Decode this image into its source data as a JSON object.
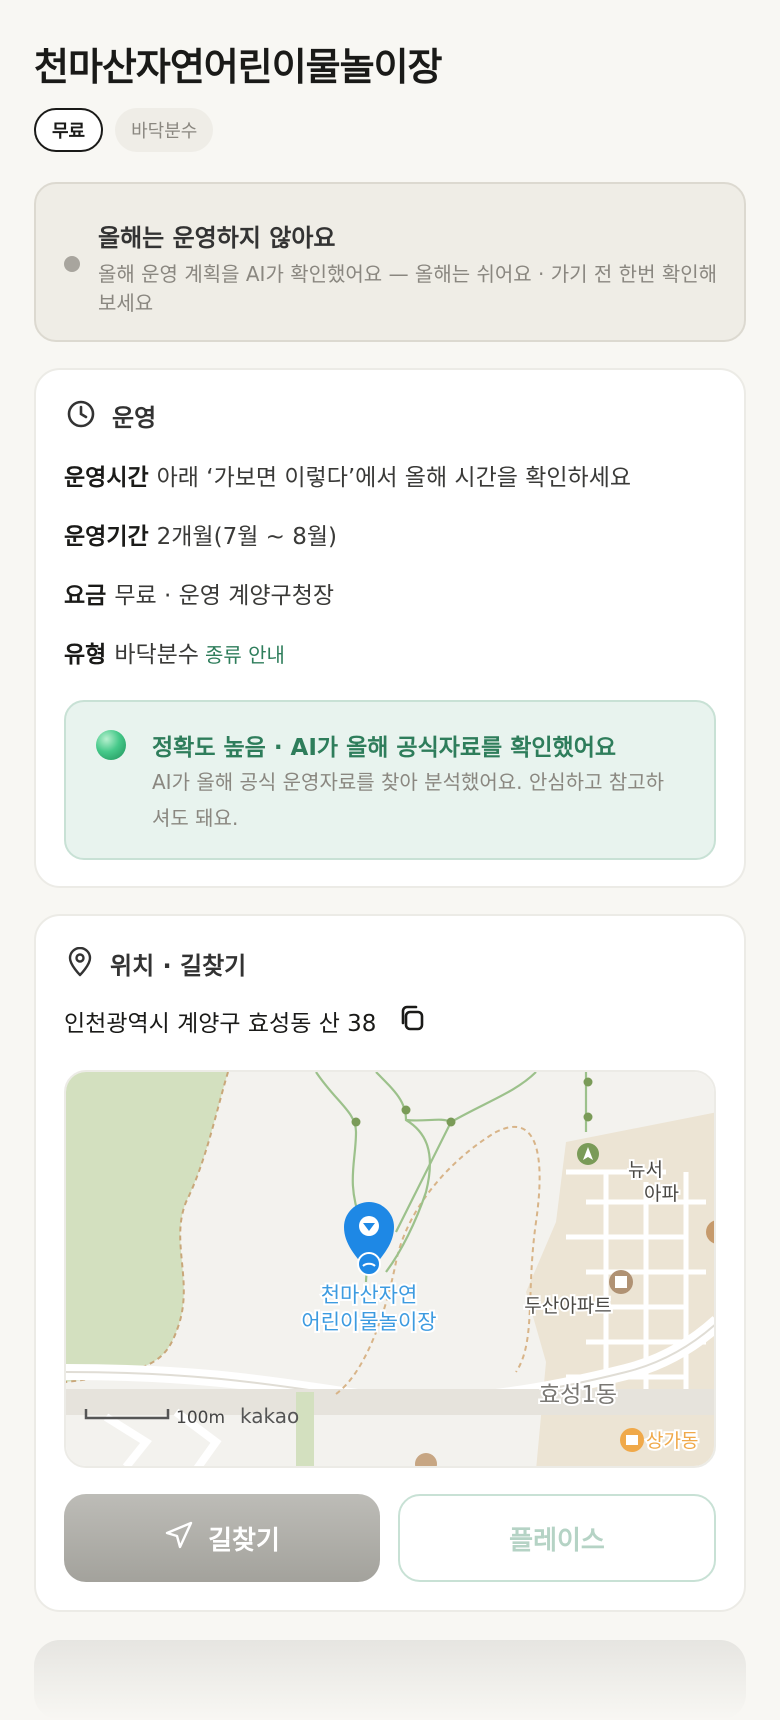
{
  "page": {
    "title": "천마산자연어린이물놀이장",
    "chips": [
      {
        "label": "무료",
        "active": true
      },
      {
        "label": "바닥분수",
        "active": false
      }
    ]
  },
  "notice": {
    "title": "올해는 운영하지 않아요",
    "desc": "올해 운영 계획을 AI가 확인했어요 — 올해는 쉬어요 · 가기 전 한번 확인해보세요"
  },
  "operation": {
    "header": "운영",
    "hours_label": "운영시간",
    "hours_value": "아래 ‘가보면 이렇다’에서 올해 시간을 확인하세요",
    "period_label": "운영기간",
    "period_value": "2개월(7월 ~ 8월)",
    "fee_label": "요금",
    "fee_value": "무료 · 운영 계양구청장",
    "type_label": "유형",
    "type_value": "바닥분수",
    "type_link": "종류 안내",
    "accuracy_title": "정확도 높음 · AI가 올해 공식자료를 확인했어요",
    "accuracy_desc": "AI가 올해 공식 운영자료를 찾아 분석했어요. 안심하고 참고하셔도 돼요."
  },
  "location": {
    "header": "위치 · 길찾기",
    "address": "인천광역시 계양구 효성동 산 38",
    "map": {
      "marker_label_line1": "천마산자연",
      "marker_label_line2": "어린이물놀이장",
      "poi_apartment": "두산아파트",
      "poi_district": "효성1동",
      "poi_newseo_1": "뉴서",
      "poi_newseo_2": "아파",
      "poi_shop": "상가동",
      "scale": "100m",
      "provider": "kakao"
    },
    "nav_button": "길찾기",
    "place_button": "플레이스"
  },
  "colors": {
    "accent_green": "#2e7d5b",
    "marker_blue": "#1e88e5",
    "background": "#f8f7f3"
  }
}
